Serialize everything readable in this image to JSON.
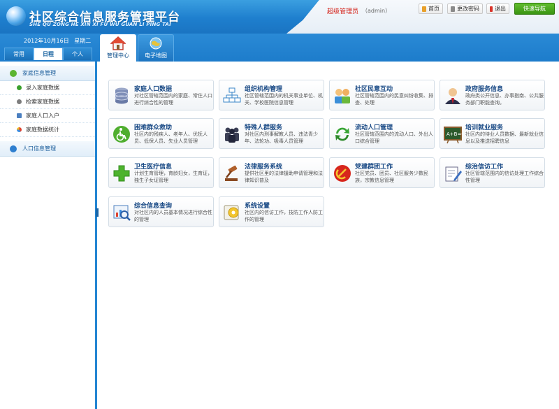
{
  "header": {
    "title": "社区综合信息服务管理平台",
    "subtitle": "SHE QU ZONG HE XIN XI FU WU GUAN LI PING TAI",
    "user_role": "超级管理员",
    "user_name": "（admin）",
    "home_label": "首页",
    "change_pwd_label": "更改密码",
    "exit_label": "退出",
    "quick_nav_label": "快速导航"
  },
  "date": {
    "date": "2012年10月16日",
    "weekday": "星期二"
  },
  "left_tabs": [
    {
      "label": "常用"
    },
    {
      "label": "日程"
    },
    {
      "label": "个人"
    }
  ],
  "main_tabs": [
    {
      "label": "管理中心",
      "icon": "home-icon"
    },
    {
      "label": "电子地图",
      "icon": "globe-icon"
    }
  ],
  "sidebar": {
    "group1": "家庭信息管理",
    "items": [
      {
        "label": "录入家庭数据"
      },
      {
        "label": "检索家庭数据"
      },
      {
        "label": "家庭人口入户"
      },
      {
        "label": "家庭数据统计"
      }
    ],
    "group2": "人口信息管理"
  },
  "cards": [
    {
      "title": "家庭人口数据",
      "desc": "对社区管辖范围内的家庭、常住人口进行综合性的管理",
      "icon": "database-icon"
    },
    {
      "title": "组织机构管理",
      "desc": "社区管辖范围内的机关事业单位、机关、学校医院信息管理",
      "icon": "org-chart-icon"
    },
    {
      "title": "社区民意互动",
      "desc": "社区管辖范围内的民意纠纷收集、排查、处理",
      "icon": "people-icon"
    },
    {
      "title": "政府服务信息",
      "desc": "政府类公开信息、办事指南、公共服务部门职能查询。",
      "icon": "government-icon"
    },
    {
      "title": "困难群众救助",
      "desc": "社区内的残疾人、老年人、优抚人员、低保人员、失业人员管理",
      "icon": "wheelchair-icon"
    },
    {
      "title": "特殊人群服务",
      "desc": "对社区内刑事解教人员、违法青少年、法轮功、吸毒人员管理",
      "icon": "crowd-icon"
    },
    {
      "title": "流动人口管理",
      "desc": "社区管辖范围内的流动人口、外出人口综合管理",
      "icon": "refresh-icon"
    },
    {
      "title": "培训就业服务",
      "desc": "社区内的待业人员数据、最新就业信息以及推送招聘信息",
      "icon": "blackboard-icon"
    },
    {
      "title": "卫生医疗信息",
      "desc": "计划生育管理，育龄妇女，生育证，独生子女证管理",
      "icon": "medical-cross-icon"
    },
    {
      "title": "法律服务系统",
      "desc": "提供社区里的法律援助申请管理和法律知识普及",
      "icon": "gavel-icon"
    },
    {
      "title": "党建群团工作",
      "desc": "社区党员、团员、社区服务少数民族，宗教信息管理",
      "icon": "party-emblem-icon"
    },
    {
      "title": "综治信访工作",
      "desc": "社区管辖范围内的信访处理工作综合性管理",
      "icon": "edit-icon"
    },
    {
      "title": "综合信息查询",
      "desc": "对社区内的人员基本情况进行综合性的管理",
      "icon": "search-chart-icon"
    },
    {
      "title": "系统设置",
      "desc": "社区内的信访工作，技防工作人防工作的管理",
      "icon": "settings-icon"
    }
  ]
}
